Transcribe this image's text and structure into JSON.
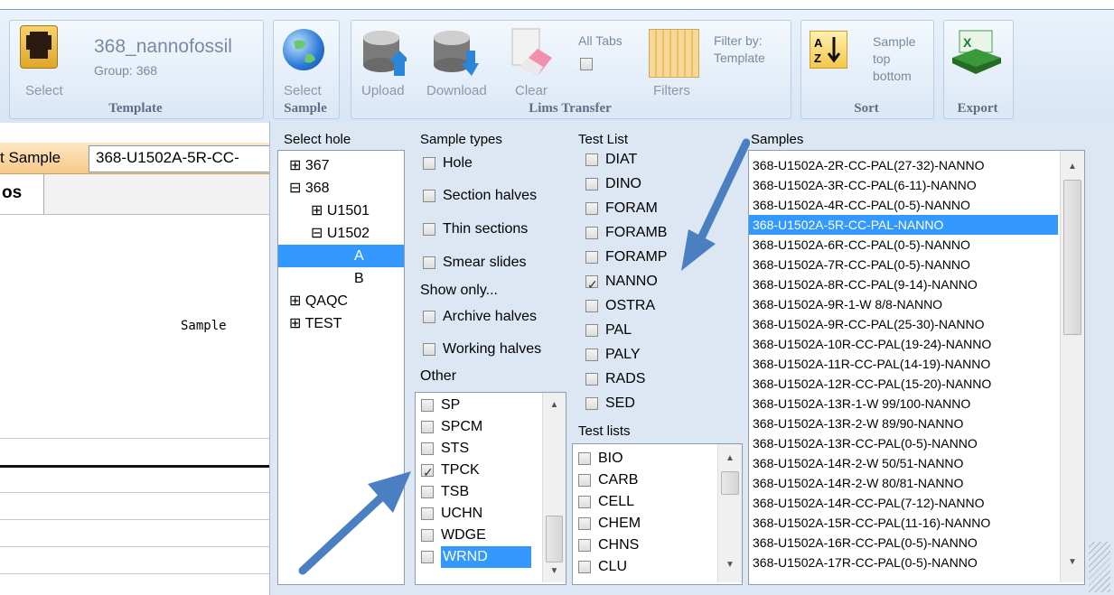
{
  "ribbon": {
    "template_group": {
      "label": "Template",
      "select_label": "Select",
      "template_name": "368_nannofossil",
      "group_text": "Group: 368"
    },
    "sample_group": {
      "select_label": "Select",
      "label": "Sample"
    },
    "lims_group": {
      "label": "Lims Transfer",
      "upload": "Upload",
      "download": "Download",
      "clear": "Clear",
      "all_tabs": "All Tabs",
      "filters": "Filters",
      "filter_by": "Filter by:",
      "filter_by_value": "Template"
    },
    "sort_group": {
      "label": "Sort",
      "line1": "Sample",
      "line2": "top",
      "line3": "bottom"
    },
    "export_group": {
      "label": "Export"
    }
  },
  "background": {
    "sample_label": "t Sample",
    "sample_value": "368-U1502A-5R-CC-",
    "tab_text": "os",
    "column_text": "Sample"
  },
  "panel": {
    "select_hole": {
      "header": "Select hole",
      "items": [
        {
          "text": "367",
          "toggle": "⊞"
        },
        {
          "text": "368",
          "toggle": "⊟"
        },
        {
          "text": "U1501",
          "toggle": "⊞"
        },
        {
          "text": "U1502",
          "toggle": "⊟"
        },
        {
          "text": "A",
          "toggle": ""
        },
        {
          "text": "B",
          "toggle": ""
        },
        {
          "text": "QAQC",
          "toggle": "⊞"
        },
        {
          "text": "TEST",
          "toggle": "⊞"
        }
      ]
    },
    "sample_types": {
      "header": "Sample types",
      "items": [
        "Hole",
        "Section halves",
        "Thin sections",
        "Smear slides"
      ],
      "show_only_label": "Show only...",
      "show_only": [
        "Archive halves",
        "Working halves"
      ],
      "other_label": "Other",
      "other_items": [
        {
          "text": "SP",
          "checked": false
        },
        {
          "text": "SPCM",
          "checked": false
        },
        {
          "text": "STS",
          "checked": false
        },
        {
          "text": "TPCK",
          "checked": true
        },
        {
          "text": "TSB",
          "checked": false
        },
        {
          "text": "UCHN",
          "checked": false
        },
        {
          "text": "WDGE",
          "checked": false
        },
        {
          "text": "WRND",
          "checked": false
        }
      ]
    },
    "test_list": {
      "header": "Test List",
      "items": [
        {
          "text": "DIAT",
          "checked": false
        },
        {
          "text": "DINO",
          "checked": false
        },
        {
          "text": "FORAM",
          "checked": false
        },
        {
          "text": "FORAMB",
          "checked": false
        },
        {
          "text": "FORAMP",
          "checked": false
        },
        {
          "text": "NANNO",
          "checked": true
        },
        {
          "text": "OSTRA",
          "checked": false
        },
        {
          "text": "PAL",
          "checked": false
        },
        {
          "text": "PALY",
          "checked": false
        },
        {
          "text": "RADS",
          "checked": false
        },
        {
          "text": "SED",
          "checked": false
        }
      ],
      "test_lists_label": "Test lists",
      "test_lists": [
        "BIO",
        "CARB",
        "CELL",
        "CHEM",
        "CHNS",
        "CLU"
      ]
    },
    "samples": {
      "header": "Samples",
      "items": [
        "368-U1502A-2R-CC-PAL(27-32)-NANNO",
        "368-U1502A-3R-CC-PAL(6-11)-NANNO",
        "368-U1502A-4R-CC-PAL(0-5)-NANNO",
        "368-U1502A-5R-CC-PAL-NANNO",
        "368-U1502A-6R-CC-PAL(0-5)-NANNO",
        "368-U1502A-7R-CC-PAL(0-5)-NANNO",
        "368-U1502A-8R-CC-PAL(9-14)-NANNO",
        "368-U1502A-9R-1-W 8/8-NANNO",
        "368-U1502A-9R-CC-PAL(25-30)-NANNO",
        "368-U1502A-10R-CC-PAL(19-24)-NANNO",
        "368-U1502A-11R-CC-PAL(14-19)-NANNO",
        "368-U1502A-12R-CC-PAL(15-20)-NANNO",
        "368-U1502A-13R-1-W 99/100-NANNO",
        "368-U1502A-13R-2-W 89/90-NANNO",
        "368-U1502A-13R-CC-PAL(0-5)-NANNO",
        "368-U1502A-14R-2-W 50/51-NANNO",
        "368-U1502A-14R-2-W 80/81-NANNO",
        "368-U1502A-14R-CC-PAL(7-12)-NANNO",
        "368-U1502A-15R-CC-PAL(11-16)-NANNO",
        "368-U1502A-16R-CC-PAL(0-5)-NANNO",
        "368-U1502A-17R-CC-PAL(0-5)-NANNO"
      ],
      "selected_index": 3
    }
  },
  "colors": {
    "selection": "#3399ff",
    "annotation_arrow": "#4a7fc1",
    "panel_bg": "#dce7f3"
  }
}
